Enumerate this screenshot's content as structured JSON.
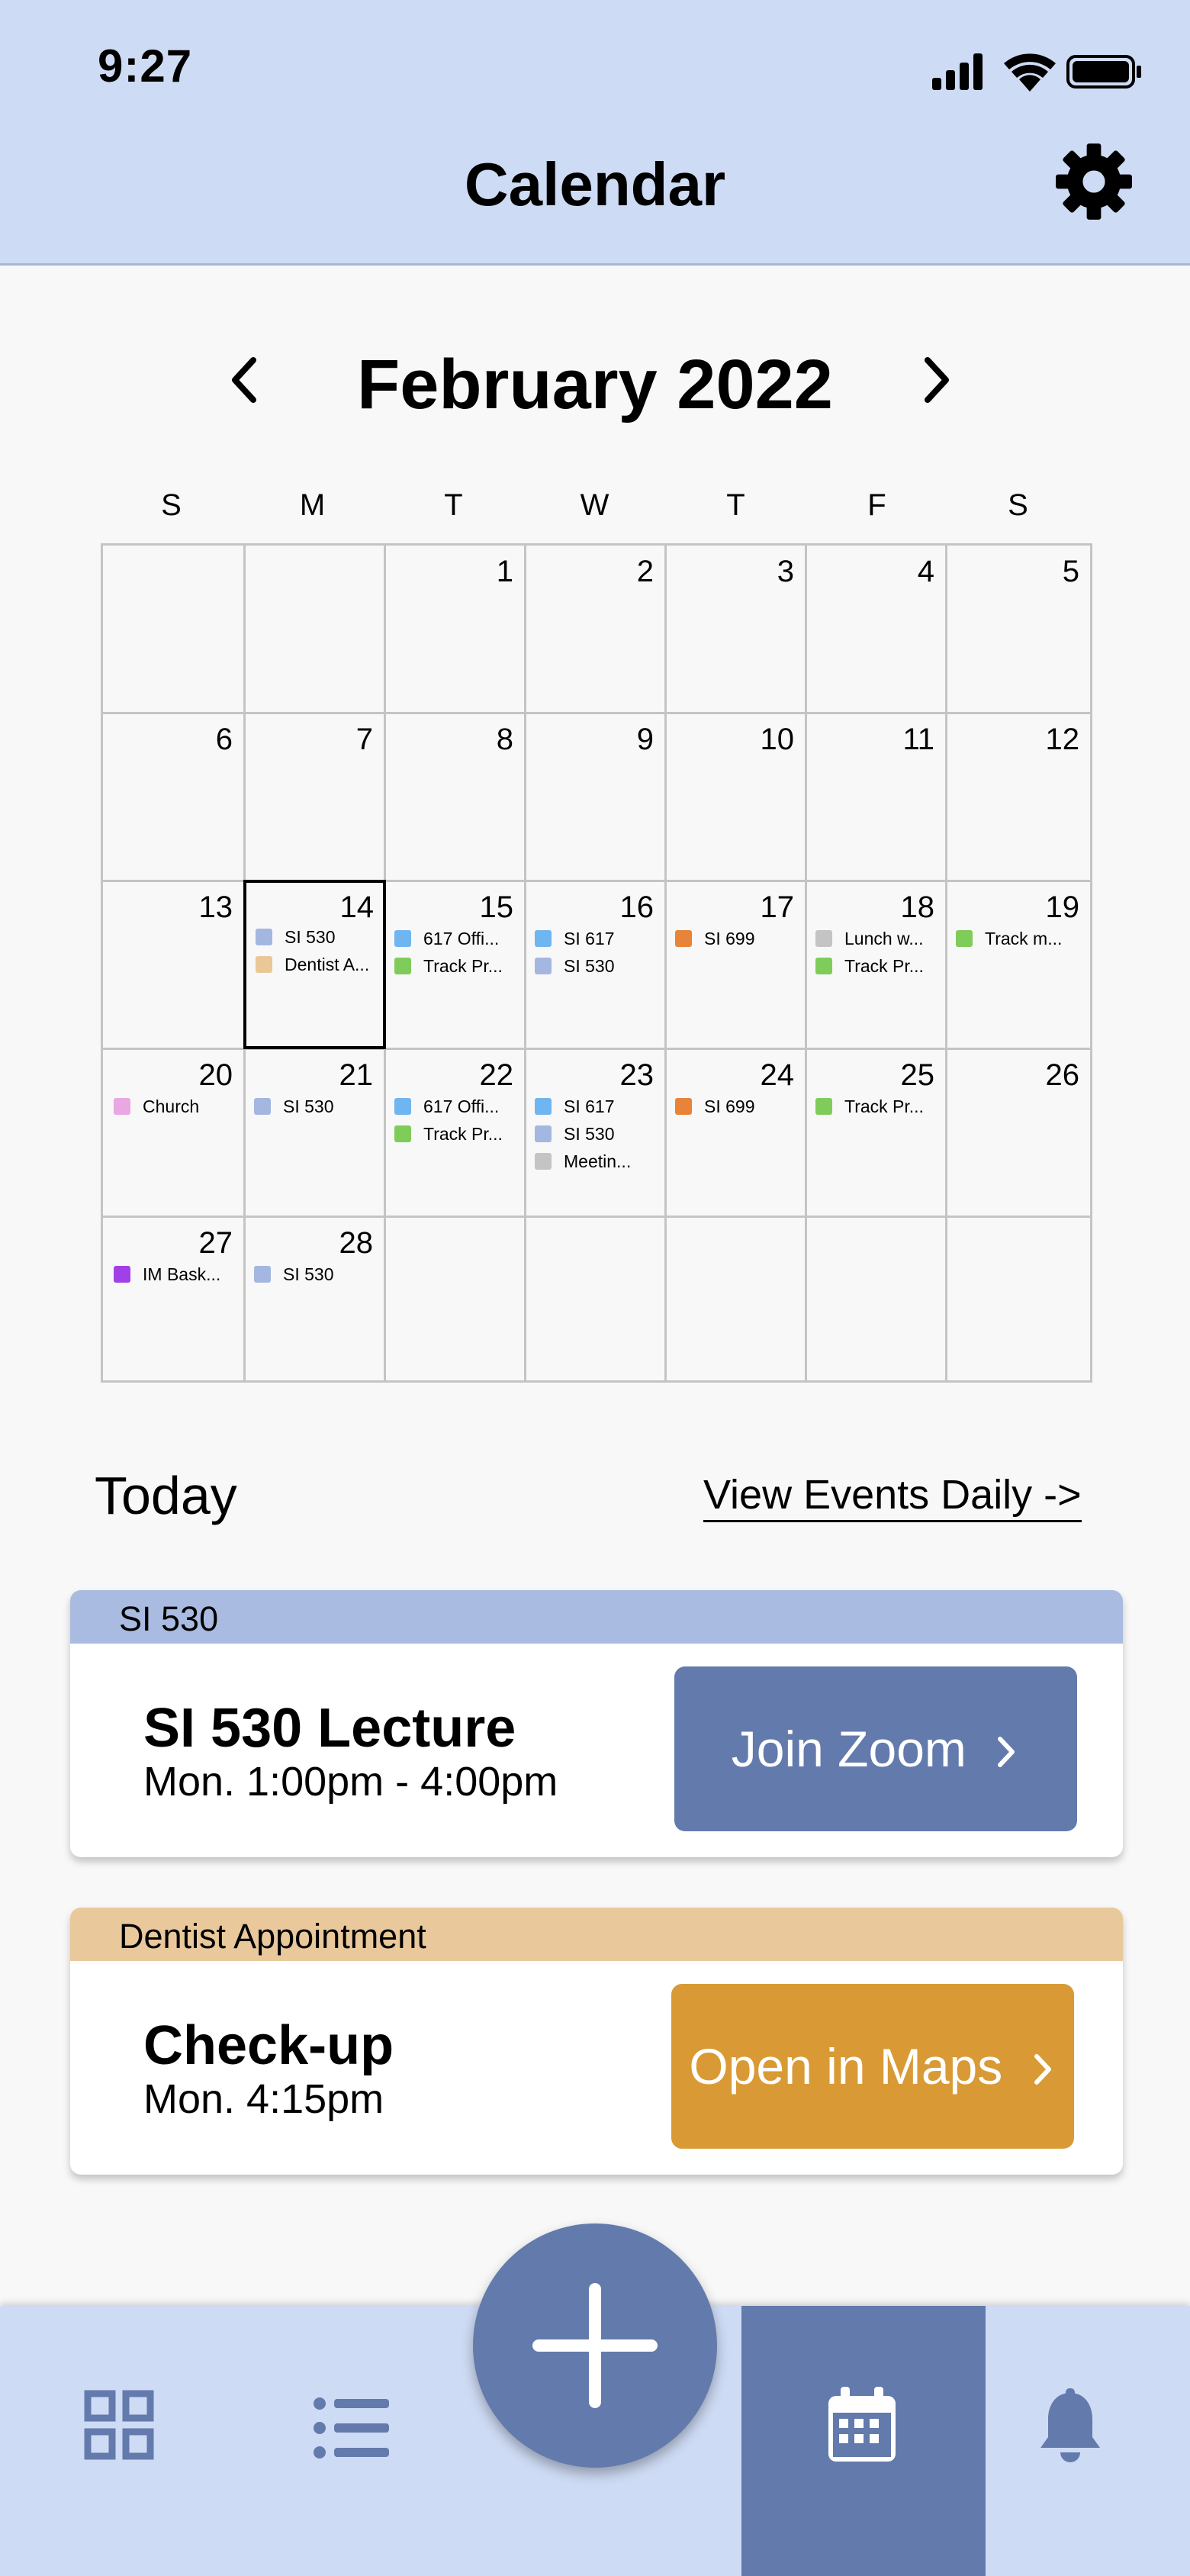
{
  "status": {
    "time": "9:27"
  },
  "header": {
    "title": "Calendar"
  },
  "calendar": {
    "month_title": "February 2022",
    "weekdays": [
      "S",
      "M",
      "T",
      "W",
      "T",
      "F",
      "S"
    ],
    "days": {
      "d1": "1",
      "d2": "2",
      "d3": "3",
      "d4": "4",
      "d5": "5",
      "d6": "6",
      "d7": "7",
      "d8": "8",
      "d9": "9",
      "d10": "10",
      "d11": "11",
      "d12": "12",
      "d13": "13",
      "d14": "14",
      "d15": "15",
      "d16": "16",
      "d17": "17",
      "d18": "18",
      "d19": "19",
      "d20": "20",
      "d21": "21",
      "d22": "22",
      "d23": "23",
      "d24": "24",
      "d25": "25",
      "d26": "26",
      "d27": "27",
      "d28": "28"
    },
    "events": {
      "e14a": "SI 530",
      "e14b": "Dentist A...",
      "e15a": "617 Offi...",
      "e15b": "Track Pr...",
      "e16a": "SI 617",
      "e16b": "SI 530",
      "e17a": "SI 699",
      "e18a": "Lunch w...",
      "e18b": "Track Pr...",
      "e19a": "Track m...",
      "e20a": "Church",
      "e21a": "SI 530",
      "e22a": "617 Offi...",
      "e22b": "Track Pr...",
      "e23a": "SI 617",
      "e23b": "SI 530",
      "e23c": "Meetin...",
      "e24a": "SI 699",
      "e25a": "Track Pr...",
      "e27a": "IM Bask...",
      "e28a": "SI 530"
    },
    "colors": {
      "si530": "#a4b7e0",
      "si617": "#6fb5f0",
      "si699": "#e8843a",
      "track": "#7fcc5a",
      "dentist": "#e9c796",
      "gray": "#c4c4c4",
      "church": "#e9a8e2",
      "im": "#a240e8"
    }
  },
  "today": {
    "label": "Today",
    "view_daily": "View Events Daily ->"
  },
  "cards": [
    {
      "category": "SI 530",
      "title": "SI 530 Lecture",
      "time": "Mon. 1:00pm - 4:00pm",
      "button": "Join Zoom",
      "head_color": "#a9bbe0",
      "button_color": "#637aad"
    },
    {
      "category": "Dentist Appointment",
      "title": "Check-up",
      "time": "Mon. 4:15pm",
      "button": "Open in Maps",
      "head_color": "#e9c99b",
      "button_color": "#d99a35"
    }
  ],
  "nav": {
    "items": [
      "dashboard-icon",
      "list-icon",
      "calendar-icon",
      "bell-icon"
    ],
    "active": "calendar",
    "accent": "#637aad"
  }
}
